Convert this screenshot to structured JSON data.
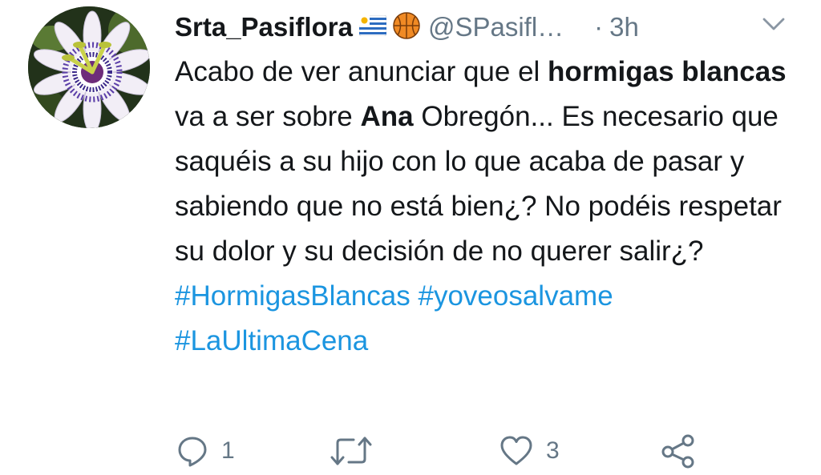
{
  "tweet": {
    "display_name": "Srta_Pasiflora",
    "handle": "@SPasifl…",
    "dot": "·",
    "time": "3h",
    "name_emoji": [
      "uruguay-flag",
      "basketball"
    ],
    "body": {
      "t1": "Acabo de ver anunciar que el ",
      "b1": "hormigas blancas",
      "t2": " va a ser sobre ",
      "b2": "Ana",
      "t3": " Obregón... Es necesario que saquéis a su hijo con lo que acaba de pasar y sabiendo que no está bien¿? No podéis respetar su dolor y su decisión de no querer salir¿?"
    },
    "hashtags": [
      "#HormigasBlancas",
      "#yoveosalvame",
      "#LaUltimaCena"
    ],
    "actions": {
      "reply_count": "1",
      "retweet_count": "",
      "like_count": "3"
    },
    "icons": [
      "reply-icon",
      "retweet-icon",
      "like-icon",
      "share-icon",
      "caret-down-icon"
    ],
    "colors": {
      "text": "#14171a",
      "muted": "#657786",
      "hashtag": "#1b95e0"
    }
  }
}
